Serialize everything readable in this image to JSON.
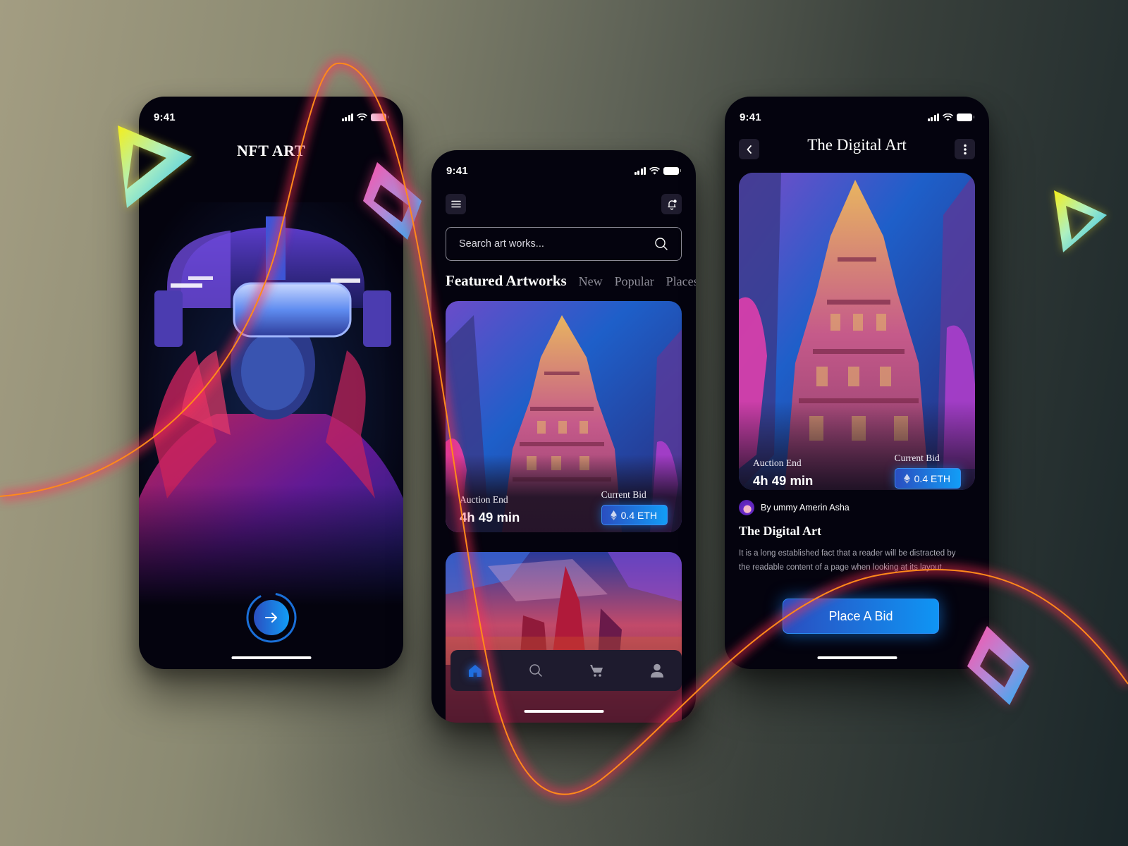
{
  "theme": {
    "accent_start": "#2a4ec0",
    "accent_end": "#129df6",
    "phone_bg": "#04030e",
    "chip_bg": "#1f1c2e",
    "neon_line": "#ff8a1a",
    "neon_glow": "#ff2d55"
  },
  "status_bar": {
    "time": "9:41"
  },
  "onboarding": {
    "title": "NFT ART",
    "hero_image": "vr-headset-portrait",
    "cta_icon": "arrow-right-icon",
    "progress": 0.9
  },
  "home": {
    "menu_icon": "menu-icon",
    "notification_icon": "bell-icon",
    "search": {
      "placeholder": "Search art works...",
      "value": ""
    },
    "tabs": [
      {
        "label": "Featured Artworks",
        "active": true
      },
      {
        "label": "New",
        "active": false
      },
      {
        "label": "Popular",
        "active": false
      },
      {
        "label": "Places",
        "active": false
      }
    ],
    "cards": [
      {
        "image": "temple-artwork",
        "auction_label": "Auction End",
        "auction_value": "4h 49 min",
        "bid_label": "Current Bid",
        "bid_value": "0.4 ETH"
      },
      {
        "image": "city-artwork"
      }
    ],
    "nav": [
      {
        "name": "home",
        "icon": "home-icon",
        "active": true
      },
      {
        "name": "search",
        "icon": "search-icon",
        "active": false
      },
      {
        "name": "cart",
        "icon": "cart-icon",
        "active": false
      },
      {
        "name": "profile",
        "icon": "user-icon",
        "active": false
      }
    ]
  },
  "detail": {
    "title": "The Digital Art",
    "back_icon": "chevron-left-icon",
    "more_icon": "more-vertical-icon",
    "auction_label": "Auction End",
    "auction_value": "4h 49 min",
    "bid_label": "Current Bid",
    "bid_value": "0.4 ETH",
    "author": "By ummy Amerin Asha",
    "heading": "The Digital Art",
    "description": "It is a long established fact that a reader will be distracted by the readable content of a page when looking at its layout.",
    "bid_button": "Place A Bid"
  }
}
